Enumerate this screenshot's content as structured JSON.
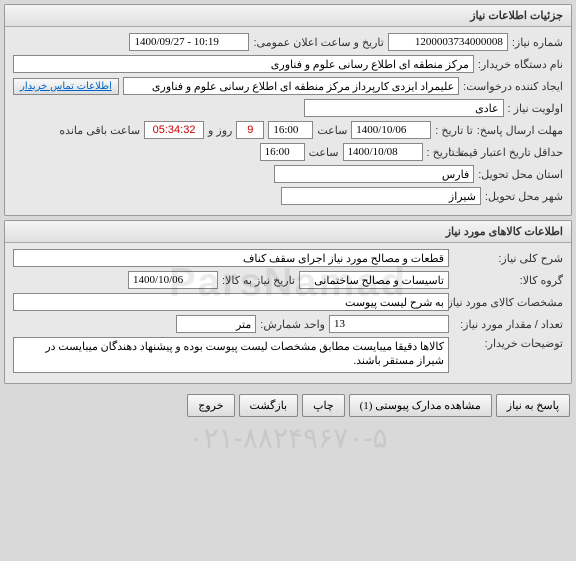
{
  "header": {
    "title": "جزئیات اطلاعات نیاز"
  },
  "section1": {
    "request_no_label": "شماره نیاز:",
    "request_no": "1200003734000008",
    "public_date_label": "تاریخ و ساعت اعلان عمومی:",
    "public_date": "1400/09/27 - 10:19",
    "buyer_org_label": "نام دستگاه خریدار:",
    "buyer_org": "مرکز منطقه ای اطلاع رسانی علوم و فناوری",
    "creator_label": "ایجاد کننده درخواست:",
    "creator": "علیمراد ایزدی کارپرداز مرکز منطقه ای اطلاع رسانی علوم و فناوری",
    "contact_link": "اطلاعات تماس خریدار",
    "priority_label": "اولویت نیاز :",
    "priority": "عادی",
    "reply_deadline_label": "مهلت ارسال پاسخ:",
    "to_date_label": "تا تاریخ :",
    "reply_date": "1400/10/06",
    "time_label": "ساعت",
    "reply_time": "16:00",
    "remaining_days": "9",
    "days_and": "روز و",
    "remaining_time": "05:34:32",
    "remaining_suffix": "ساعت باقی مانده",
    "validity_label": "حداقل تاریخ اعتبار قیمت:",
    "validity_date": "1400/10/08",
    "validity_time": "16:00",
    "delivery_province_label": "استان محل تحویل:",
    "delivery_province": "فارس",
    "delivery_city_label": "شهر محل تحویل:",
    "delivery_city": "شیراز"
  },
  "section2": {
    "title": "اطلاعات کالاهای مورد نیاز",
    "overall_desc_label": "شرح کلی نیاز:",
    "overall_desc": "قطعات و مصالح مورد نیاز اجرای سقف کناف",
    "goods_group_label": "گروه کالا:",
    "goods_group": "تاسیسات و مصالح ساختمانی",
    "need_date_label": "تاریخ نیاز به کالا:",
    "need_date": "1400/10/06",
    "goods_spec_label": "مشخصات کالای مورد نیاز:",
    "goods_spec": "به شرح لیست پیوست",
    "qty_label": "تعداد / مقدار مورد نیاز:",
    "qty": "13",
    "unit_label": "واحد شمارش:",
    "unit": "متر",
    "buyer_notes_label": "توضیحات خریدار:",
    "buyer_notes": "کالاها دقیقا میبایست مطابق مشخصات لیست پیوست بوده و پیشنهاد دهندگان میبایست در شیراز مستقر باشند."
  },
  "buttons": {
    "reply": "پاسخ به نیاز",
    "attachments": "مشاهده مدارک پیوستی (1)",
    "print": "چاپ",
    "back": "بازگشت",
    "exit": "خروج"
  }
}
